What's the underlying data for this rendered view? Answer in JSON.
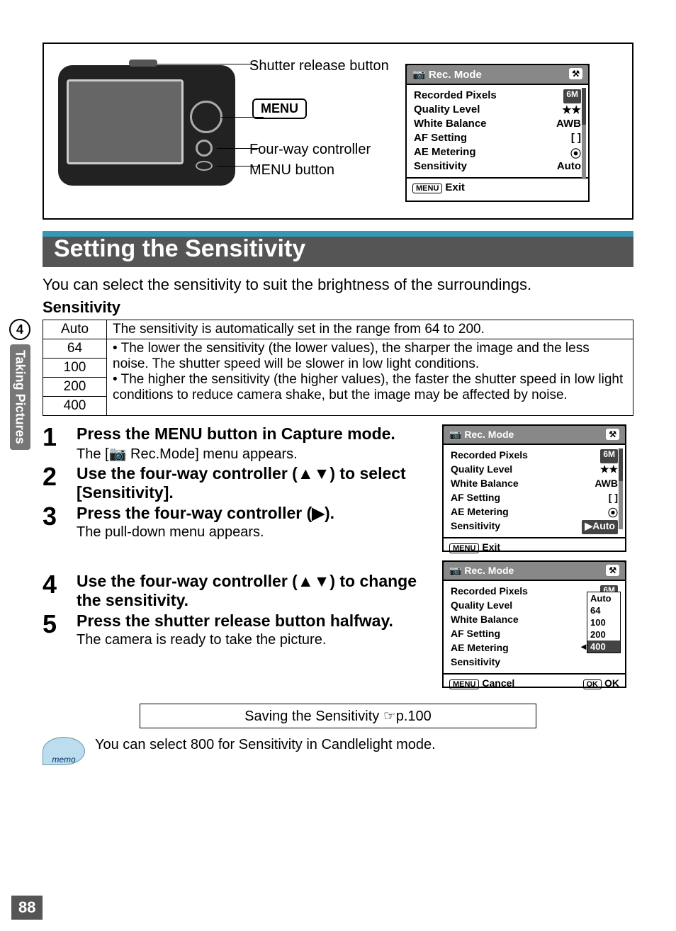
{
  "diagram": {
    "shutter_label": "Shutter release button",
    "menu_badge": "MENU",
    "fourway_label": "Four-way controller",
    "menu_btn_label": "MENU button"
  },
  "lcd_top": {
    "title": "Rec. Mode",
    "tool_icon": "⚒",
    "rows": [
      {
        "k": "Recorded Pixels",
        "v": "6M",
        "badge": true
      },
      {
        "k": "Quality Level",
        "v": "★★"
      },
      {
        "k": "White Balance",
        "v": "AWB"
      },
      {
        "k": "AF Setting",
        "v": "[  ]"
      },
      {
        "k": "AE Metering",
        "v": "⦿"
      },
      {
        "k": "Sensitivity",
        "v": "Auto"
      }
    ],
    "foot_key": "MENU",
    "foot_text": "Exit"
  },
  "heading": "Setting the Sensitivity",
  "intro": "You can select the sensitivity to suit the brightness of the surroundings.",
  "subhead": "Sensitivity",
  "table": {
    "auto_label": "Auto",
    "auto_desc": "The sensitivity is automatically set in the range from 64 to 200.",
    "v64": "64",
    "v100": "100",
    "v200": "200",
    "v400": "400",
    "bullet1": "The lower the sensitivity (the lower values), the sharper the image and the less noise. The shutter speed will be slower in low light conditions.",
    "bullet2": "The higher the sensitivity (the higher values), the faster the shutter speed in low light conditions to reduce camera shake, but the image may be affected by noise."
  },
  "steps": {
    "s1_title": "Press the MENU button in Capture mode.",
    "s1_desc": "The [📷 Rec.Mode] menu appears.",
    "s2_title": "Use the four-way controller (▲▼) to select [Sensitivity].",
    "s3_title": "Press the four-way controller (▶).",
    "s3_desc": "The pull-down menu appears.",
    "s4_title": "Use the four-way controller (▲▼) to change the sensitivity.",
    "s5_title": "Press the shutter release button halfway.",
    "s5_desc": "The camera is ready to take the picture."
  },
  "lcd_mid": {
    "title": "Rec. Mode",
    "rows": [
      {
        "k": "Recorded Pixels",
        "v": "6M",
        "badge": true
      },
      {
        "k": "Quality Level",
        "v": "★★"
      },
      {
        "k": "White Balance",
        "v": "AWB"
      },
      {
        "k": "AF Setting",
        "v": "[  ]"
      },
      {
        "k": "AE Metering",
        "v": "⦿"
      },
      {
        "k": "Sensitivity",
        "v": "▶Auto",
        "hl": true
      }
    ],
    "foot_key": "MENU",
    "foot_text": "Exit"
  },
  "lcd_bot": {
    "title": "Rec. Mode",
    "rows": [
      {
        "k": "Recorded Pixels",
        "v": "6M",
        "badge": true
      },
      {
        "k": "Quality Level",
        "v": ""
      },
      {
        "k": "White Balance",
        "v": ""
      },
      {
        "k": "AF Setting",
        "v": ""
      },
      {
        "k": "AE Metering",
        "v": ""
      },
      {
        "k": "Sensitivity",
        "v": "",
        "hl": true
      }
    ],
    "dropdown": [
      "Auto",
      "64",
      "100",
      "200",
      "400"
    ],
    "dropdown_sel": "400",
    "foot_key": "MENU",
    "foot_text": "Cancel",
    "foot_ok_key": "OK",
    "foot_ok": "OK"
  },
  "save_note": "Saving the Sensitivity ☞p.100",
  "memo": {
    "icon_text": "memo",
    "text": "You can select 800 for Sensitivity in Candlelight mode."
  },
  "side": {
    "chapter_num": "4",
    "chapter_label": "Taking Pictures"
  },
  "page_num": "88"
}
